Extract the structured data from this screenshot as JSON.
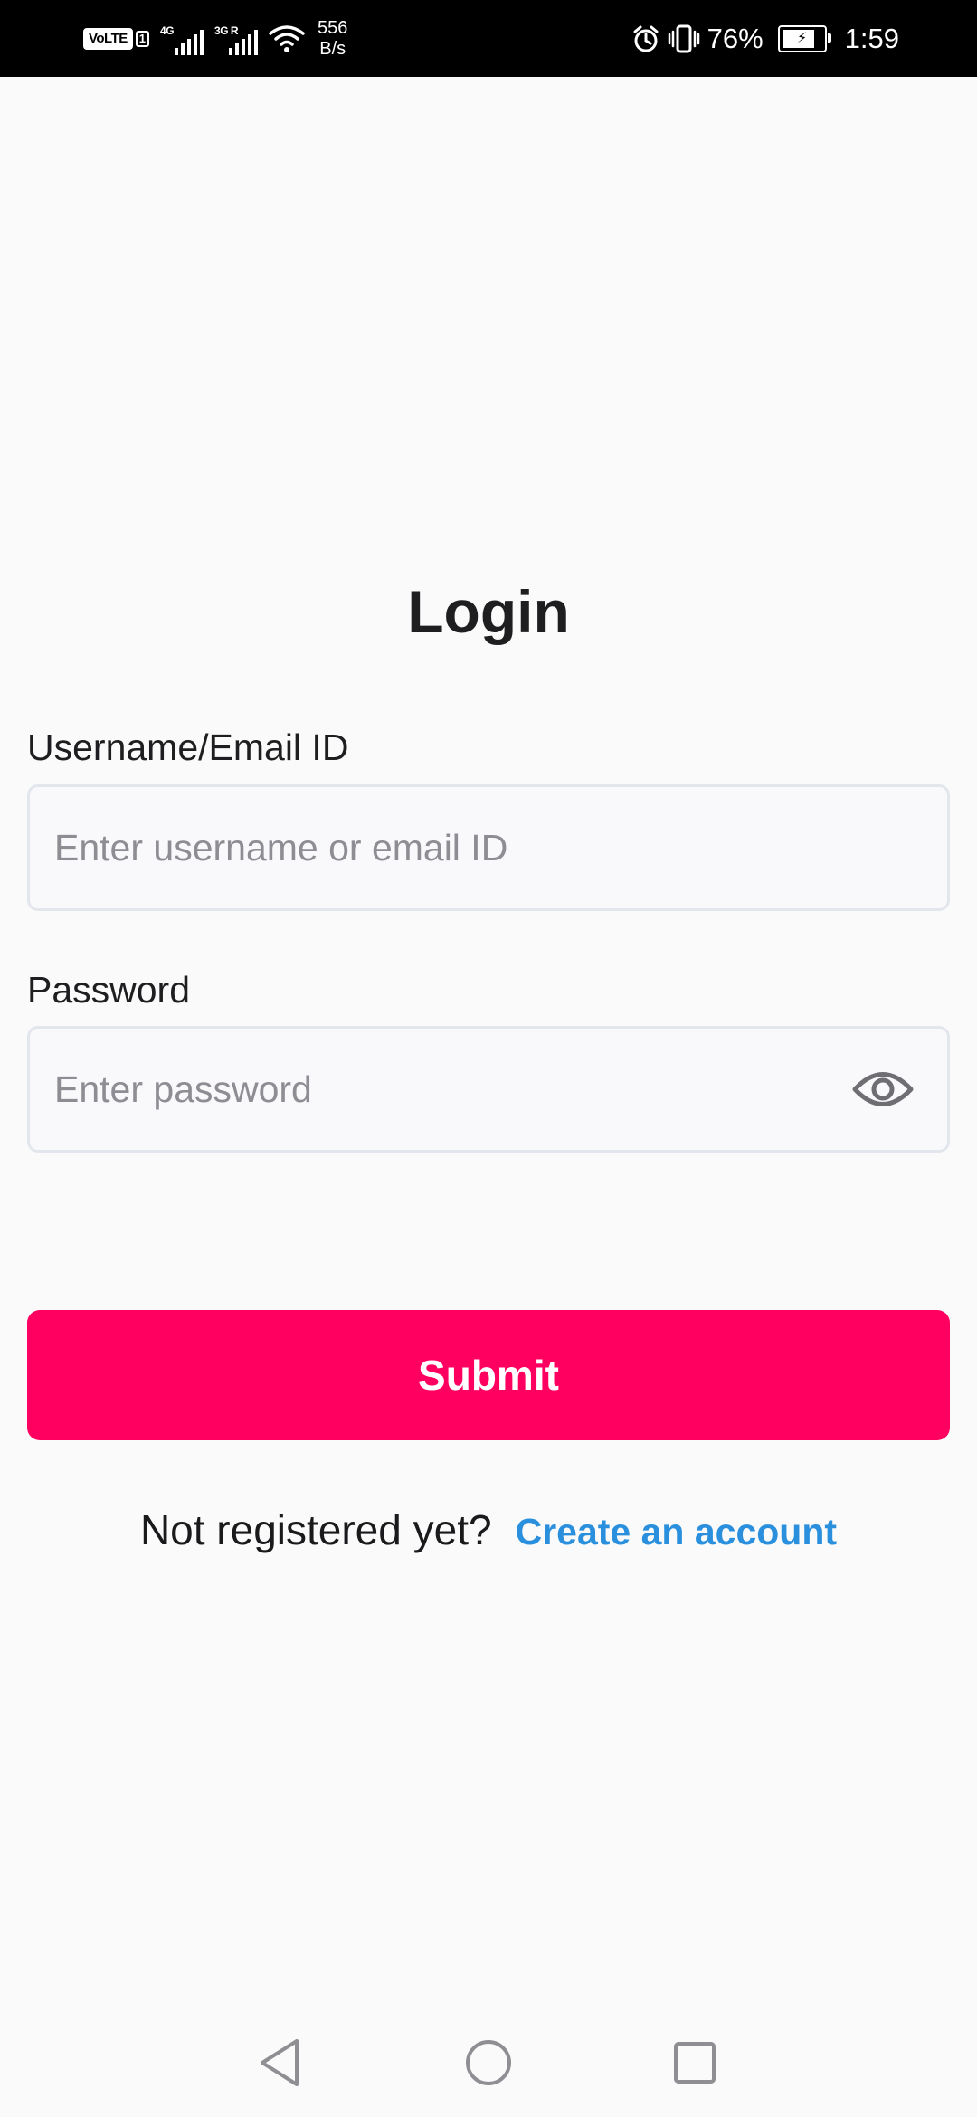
{
  "status_bar": {
    "volte": "VoLTE",
    "sim_slot": "1",
    "network_1": "4G",
    "network_2": "3G R",
    "speed_value": "556",
    "speed_unit": "B/s",
    "battery": "76%",
    "time": "1:59"
  },
  "login": {
    "title": "Login",
    "username_label": "Username/Email ID",
    "username_placeholder": "Enter username or email ID",
    "username_value": "",
    "password_label": "Password",
    "password_placeholder": "Enter password",
    "password_value": "",
    "submit_label": "Submit"
  },
  "register": {
    "prompt": "Not registered yet?",
    "link": "Create an account"
  },
  "colors": {
    "primary": "#ff0060",
    "link": "#2a90dd",
    "background": "#fafafb",
    "field_border": "#e4e6ee"
  },
  "icons": {
    "password_toggle": "eye-icon",
    "nav_back": "back-triangle-icon",
    "nav_home": "home-circle-icon",
    "nav_recents": "recents-square-icon"
  }
}
